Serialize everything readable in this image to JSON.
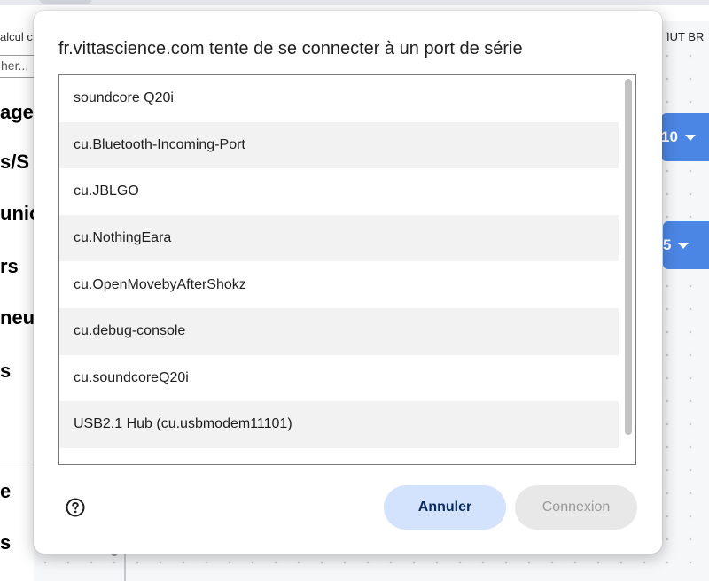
{
  "background": {
    "left_panel": {
      "calc_text": "alcul c",
      "search_text": "her...",
      "categories": [
        {
          "label": "age",
          "color": "#f28c3b"
        },
        {
          "label": "s/S",
          "color": "#4d7be0"
        },
        {
          "label": "unic",
          "color": "#6bb24a"
        },
        {
          "label": "rs",
          "color": "#9b6fe8"
        },
        {
          "label": "neu",
          "color": "#e0506a"
        },
        {
          "label": "s",
          "color": "#3c4fb8"
        },
        {
          "label": "e",
          "color": "#f28c3b"
        },
        {
          "label": "s",
          "color": "#57b96a"
        }
      ]
    },
    "top_right_text": "IUT BR",
    "blocks": [
      {
        "value": "10"
      },
      {
        "value": "5"
      }
    ]
  },
  "dialog": {
    "title": "fr.vittascience.com tente de se connecter à un port de série",
    "ports": [
      "soundcore Q20i",
      "cu.Bluetooth-Incoming-Port",
      "cu.JBLGO",
      "cu.NothingEara",
      "cu.OpenMovebyAfterShokz",
      "cu.debug-console",
      "cu.soundcoreQ20i",
      "USB2.1 Hub (cu.usbmodem11101)"
    ],
    "help_icon": "help-circle-icon",
    "cancel_label": "Annuler",
    "connect_label": "Connexion"
  },
  "colors": {
    "cancel_bg": "#d3e3fd",
    "connect_bg_disabled": "#e8e8e8",
    "block_blue": "#4c86e4"
  }
}
